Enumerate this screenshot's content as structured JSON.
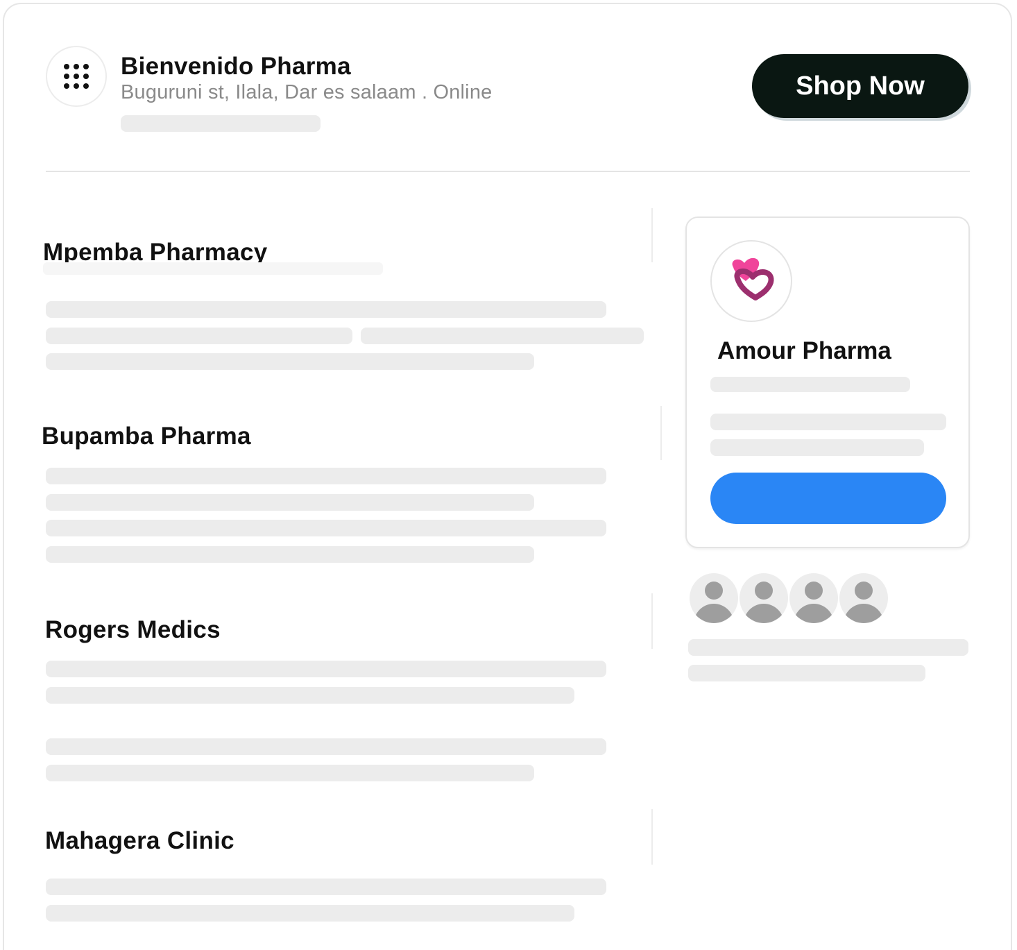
{
  "header": {
    "store_name": "Bienvenido Pharma",
    "store_address": "Buguruni st, Ilala, Dar es salaam . Online",
    "shop_button_label": "Shop Now",
    "menu_icon": "grid-dots-icon"
  },
  "listings": [
    {
      "name": "Mpemba  Pharmacy"
    },
    {
      "name": "Bupamba Pharma"
    },
    {
      "name": "Rogers Medics"
    },
    {
      "name": "Mahagera Clinic"
    }
  ],
  "featured_card": {
    "name": "Amour Pharma",
    "logo_icon": "heart-logo-icon",
    "button_color": "#2a86f5"
  },
  "avatars": [
    "user-avatar-icon",
    "user-avatar-icon",
    "user-avatar-icon",
    "user-avatar-icon"
  ],
  "colors": {
    "shop_button_bg": "#0a1712",
    "accent_blue": "#2a86f5",
    "logo_pink": "#f0449a",
    "logo_purple": "#9c2f6e"
  }
}
